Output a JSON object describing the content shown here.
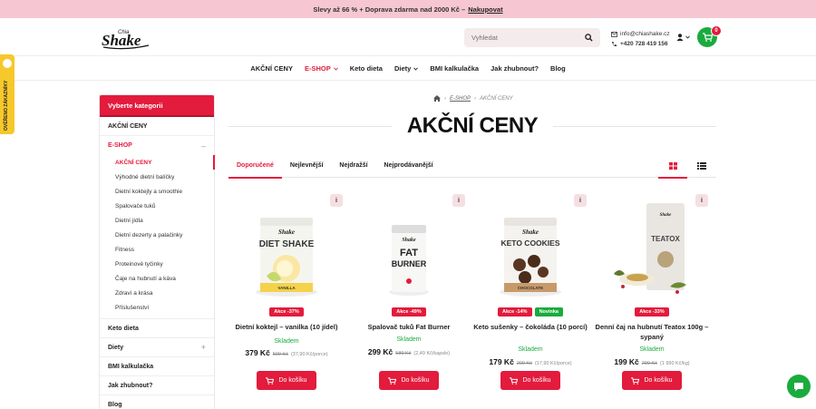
{
  "promo": {
    "text": "Slevy až 66 % + Doprava zdarma nad 2000 Kč –",
    "link": "Nakupovat"
  },
  "header": {
    "logo_text": "Shake",
    "logo_small": "Chia",
    "search_placeholder": "Vyhledat",
    "email": "info@chiashake.cz",
    "phone": "+420 728 419 156",
    "cart_count": "0"
  },
  "nav": {
    "items": [
      {
        "label": "AKČNÍ CENY"
      },
      {
        "label": "E-SHOP"
      },
      {
        "label": "Keto dieta"
      },
      {
        "label": "Diety"
      },
      {
        "label": "BMI kalkulačka"
      },
      {
        "label": "Jak zhubnout?"
      },
      {
        "label": "Blog"
      }
    ]
  },
  "side_tab": {
    "text": "OVĚŘENO ZÁKAZNÍKY"
  },
  "sidebar": {
    "title": "Vyberte kategorii",
    "top": "AKČNÍ CENY",
    "eshop": "E-SHOP",
    "eshop_toggle": "–",
    "subs": [
      "AKČNÍ CENY",
      "Výhodné dietní balíčky",
      "Dietní koktejly a smoothie",
      "Spalovače tuků",
      "Dietní jídla",
      "Dietní dezerty a palačinky",
      "Fitness",
      "Proteinové tyčinky",
      "Čaje na hubnutí a káva",
      "Zdraví a krása",
      "Příslušenství"
    ],
    "bottom": [
      {
        "label": "Keto dieta",
        "toggle": ""
      },
      {
        "label": "Diety",
        "toggle": "+"
      },
      {
        "label": "BMI kalkulačka",
        "toggle": ""
      },
      {
        "label": "Jak zhubnout?",
        "toggle": ""
      },
      {
        "label": "Blog",
        "toggle": ""
      }
    ]
  },
  "breadcrumb": {
    "sep1": "›",
    "eshop": "E-SHOP",
    "sep2": "›",
    "current": "AKČNÍ CENY"
  },
  "page_title": "AKČNÍ CENY",
  "sort_tabs": [
    "Doporučené",
    "Nejlevnější",
    "Nejdražší",
    "Nejprodávanější"
  ],
  "products": [
    {
      "info": "i",
      "badge": "Akce -37%",
      "badge2": "",
      "name": "Dietní koktejl – vanilka (10 jídel)",
      "stock": "Skladem",
      "price": "379 Kč",
      "old_price": "599 Kč",
      "unit_price": "(37,90 Kč/porce)",
      "cart_label": "Do košíku",
      "pack_brand": "Shake",
      "pack_name": "DIET SHAKE",
      "pack_flavor": "VANILLA"
    },
    {
      "info": "i",
      "badge": "Akce -49%",
      "badge2": "",
      "name": "Spalovač tuků Fat Burner",
      "stock": "Skladem",
      "price": "299 Kč",
      "old_price": "589 Kč",
      "unit_price": "(2,49 Kč/kapsle)",
      "cart_label": "Do košíku",
      "pack_brand": "Shake",
      "pack_name1": "FAT",
      "pack_name2": "BURNER"
    },
    {
      "info": "i",
      "badge": "Akce -14%",
      "badge2": "Novinka",
      "name": "Keto sušenky – čokoláda (10 porcí)",
      "stock": "Skladem",
      "price": "179 Kč",
      "old_price": "209 Kč",
      "unit_price": "(17,90 Kč/porce)",
      "cart_label": "Do košíku",
      "pack_brand": "Shake",
      "pack_name": "KETO COOKIES",
      "pack_flavor": "CHOCOLATE"
    },
    {
      "info": "i",
      "badge": "Akce -33%",
      "badge2": "",
      "name": "Denní čaj na hubnutí Teatox 100g – sypaný",
      "stock": "Skladem",
      "price": "199 Kč",
      "old_price": "299 Kč",
      "unit_price": "(1 990 Kč/kg)",
      "cart_label": "Do košíku",
      "pack_brand": "Shake",
      "pack_name": "TEATOX"
    }
  ]
}
